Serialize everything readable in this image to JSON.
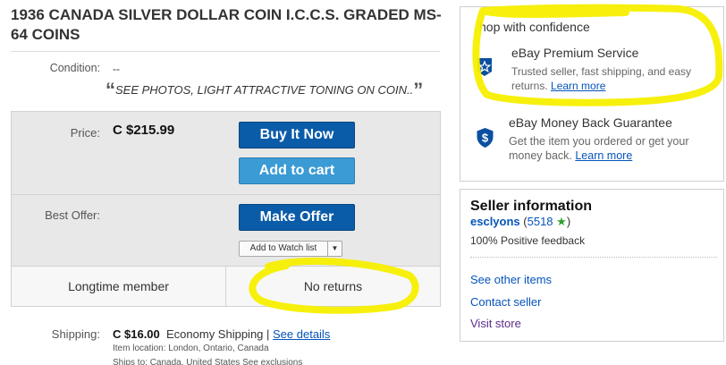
{
  "listing": {
    "title": "1936 CANADA SILVER DOLLAR COIN I.C.C.S. GRADED MS-64 COINS",
    "condition_label": "Condition:",
    "condition_value": "--",
    "condition_quote": "SEE PHOTOS, LIGHT ATTRACTIVE TONING ON COIN..",
    "price_label": "Price:",
    "price_value": "C $215.99",
    "buy_now_label": "Buy It Now",
    "add_to_cart_label": "Add to cart",
    "best_offer_label": "Best Offer:",
    "make_offer_label": "Make Offer",
    "watch_label": "Add to Watch list",
    "longtime_member": "Longtime member",
    "no_returns": "No returns",
    "shipping_label": "Shipping:",
    "shipping_cost": "C $16.00",
    "shipping_method": "Economy Shipping | ",
    "shipping_details_link": "See details",
    "item_location": "Item location:  London, Ontario, Canada",
    "ships_to": "Ships to:  Canada, United States  See exclusions"
  },
  "confidence": {
    "title": "hop with confidence",
    "premium_title": "eBay Premium Service",
    "premium_desc": "Trusted seller, fast shipping, and easy returns. ",
    "premium_link": "Learn more",
    "mbg_title": "eBay Money Back Guarantee",
    "mbg_desc": "Get the item you ordered or get your money back. ",
    "mbg_link": "Learn more"
  },
  "seller": {
    "title": "Seller information",
    "name": "esclyons",
    "score_open": " (",
    "score": "5518",
    "score_close": ")",
    "feedback": "100% Positive feedback",
    "links": [
      "See other items",
      "Contact seller",
      "Visit store"
    ]
  },
  "colors": {
    "primary_button": "#0b5ca8",
    "secondary_button": "#3a9bd5",
    "link": "#0654ba",
    "highlighter": "#f7ef00"
  },
  "icons": {
    "premium": "star-badge-icon",
    "money_back": "shield-dollar-icon",
    "seller_star": "green-star-icon",
    "watch_dropdown": "caret-down-icon"
  }
}
